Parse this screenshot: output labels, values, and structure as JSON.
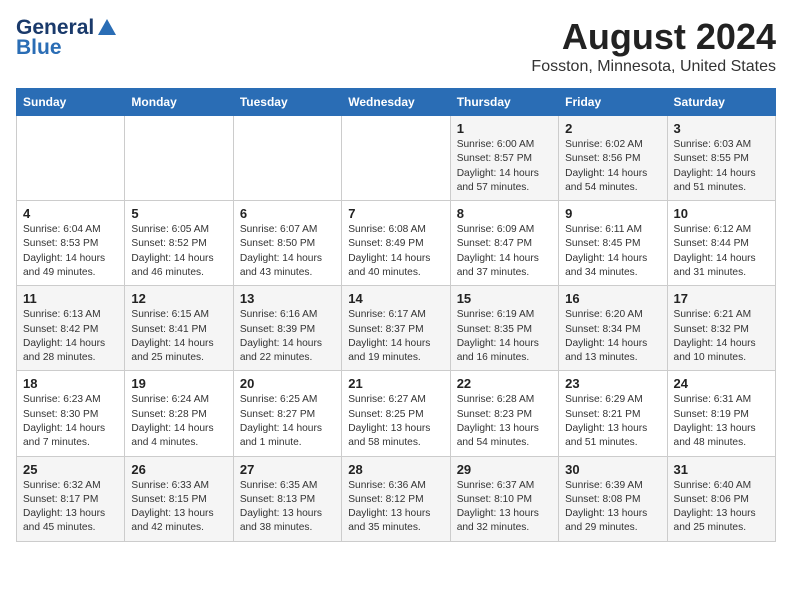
{
  "header": {
    "logo_general": "General",
    "logo_blue": "Blue",
    "month_title": "August 2024",
    "location": "Fosston, Minnesota, United States"
  },
  "days_of_week": [
    "Sunday",
    "Monday",
    "Tuesday",
    "Wednesday",
    "Thursday",
    "Friday",
    "Saturday"
  ],
  "weeks": [
    [
      {
        "day": "",
        "info": ""
      },
      {
        "day": "",
        "info": ""
      },
      {
        "day": "",
        "info": ""
      },
      {
        "day": "",
        "info": ""
      },
      {
        "day": "1",
        "info": "Sunrise: 6:00 AM\nSunset: 8:57 PM\nDaylight: 14 hours\nand 57 minutes."
      },
      {
        "day": "2",
        "info": "Sunrise: 6:02 AM\nSunset: 8:56 PM\nDaylight: 14 hours\nand 54 minutes."
      },
      {
        "day": "3",
        "info": "Sunrise: 6:03 AM\nSunset: 8:55 PM\nDaylight: 14 hours\nand 51 minutes."
      }
    ],
    [
      {
        "day": "4",
        "info": "Sunrise: 6:04 AM\nSunset: 8:53 PM\nDaylight: 14 hours\nand 49 minutes."
      },
      {
        "day": "5",
        "info": "Sunrise: 6:05 AM\nSunset: 8:52 PM\nDaylight: 14 hours\nand 46 minutes."
      },
      {
        "day": "6",
        "info": "Sunrise: 6:07 AM\nSunset: 8:50 PM\nDaylight: 14 hours\nand 43 minutes."
      },
      {
        "day": "7",
        "info": "Sunrise: 6:08 AM\nSunset: 8:49 PM\nDaylight: 14 hours\nand 40 minutes."
      },
      {
        "day": "8",
        "info": "Sunrise: 6:09 AM\nSunset: 8:47 PM\nDaylight: 14 hours\nand 37 minutes."
      },
      {
        "day": "9",
        "info": "Sunrise: 6:11 AM\nSunset: 8:45 PM\nDaylight: 14 hours\nand 34 minutes."
      },
      {
        "day": "10",
        "info": "Sunrise: 6:12 AM\nSunset: 8:44 PM\nDaylight: 14 hours\nand 31 minutes."
      }
    ],
    [
      {
        "day": "11",
        "info": "Sunrise: 6:13 AM\nSunset: 8:42 PM\nDaylight: 14 hours\nand 28 minutes."
      },
      {
        "day": "12",
        "info": "Sunrise: 6:15 AM\nSunset: 8:41 PM\nDaylight: 14 hours\nand 25 minutes."
      },
      {
        "day": "13",
        "info": "Sunrise: 6:16 AM\nSunset: 8:39 PM\nDaylight: 14 hours\nand 22 minutes."
      },
      {
        "day": "14",
        "info": "Sunrise: 6:17 AM\nSunset: 8:37 PM\nDaylight: 14 hours\nand 19 minutes."
      },
      {
        "day": "15",
        "info": "Sunrise: 6:19 AM\nSunset: 8:35 PM\nDaylight: 14 hours\nand 16 minutes."
      },
      {
        "day": "16",
        "info": "Sunrise: 6:20 AM\nSunset: 8:34 PM\nDaylight: 14 hours\nand 13 minutes."
      },
      {
        "day": "17",
        "info": "Sunrise: 6:21 AM\nSunset: 8:32 PM\nDaylight: 14 hours\nand 10 minutes."
      }
    ],
    [
      {
        "day": "18",
        "info": "Sunrise: 6:23 AM\nSunset: 8:30 PM\nDaylight: 14 hours\nand 7 minutes."
      },
      {
        "day": "19",
        "info": "Sunrise: 6:24 AM\nSunset: 8:28 PM\nDaylight: 14 hours\nand 4 minutes."
      },
      {
        "day": "20",
        "info": "Sunrise: 6:25 AM\nSunset: 8:27 PM\nDaylight: 14 hours\nand 1 minute."
      },
      {
        "day": "21",
        "info": "Sunrise: 6:27 AM\nSunset: 8:25 PM\nDaylight: 13 hours\nand 58 minutes."
      },
      {
        "day": "22",
        "info": "Sunrise: 6:28 AM\nSunset: 8:23 PM\nDaylight: 13 hours\nand 54 minutes."
      },
      {
        "day": "23",
        "info": "Sunrise: 6:29 AM\nSunset: 8:21 PM\nDaylight: 13 hours\nand 51 minutes."
      },
      {
        "day": "24",
        "info": "Sunrise: 6:31 AM\nSunset: 8:19 PM\nDaylight: 13 hours\nand 48 minutes."
      }
    ],
    [
      {
        "day": "25",
        "info": "Sunrise: 6:32 AM\nSunset: 8:17 PM\nDaylight: 13 hours\nand 45 minutes."
      },
      {
        "day": "26",
        "info": "Sunrise: 6:33 AM\nSunset: 8:15 PM\nDaylight: 13 hours\nand 42 minutes."
      },
      {
        "day": "27",
        "info": "Sunrise: 6:35 AM\nSunset: 8:13 PM\nDaylight: 13 hours\nand 38 minutes."
      },
      {
        "day": "28",
        "info": "Sunrise: 6:36 AM\nSunset: 8:12 PM\nDaylight: 13 hours\nand 35 minutes."
      },
      {
        "day": "29",
        "info": "Sunrise: 6:37 AM\nSunset: 8:10 PM\nDaylight: 13 hours\nand 32 minutes."
      },
      {
        "day": "30",
        "info": "Sunrise: 6:39 AM\nSunset: 8:08 PM\nDaylight: 13 hours\nand 29 minutes."
      },
      {
        "day": "31",
        "info": "Sunrise: 6:40 AM\nSunset: 8:06 PM\nDaylight: 13 hours\nand 25 minutes."
      }
    ]
  ]
}
